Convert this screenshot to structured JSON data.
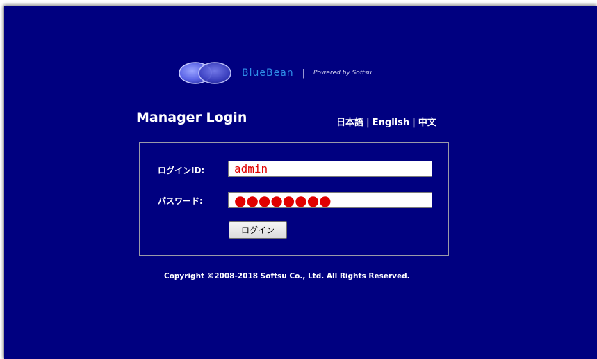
{
  "logo": {
    "icon": "bean-logo-icon",
    "brand": "BlueBean",
    "separator": "|",
    "powered_by": "Powered by Softsu"
  },
  "header": {
    "title": "Manager Login"
  },
  "languages": {
    "japanese": "日本語",
    "english": "English",
    "chinese": "中文",
    "separator": "|"
  },
  "form": {
    "login_id_label": "ログインID:",
    "login_id_value": "admin",
    "password_label": "パスワード:",
    "password_value": "●●●●●●●●",
    "submit_label": "ログイン"
  },
  "footer": {
    "copyright": "Copyright ©2008-2018 Softsu Co., Ltd. All Rights Reserved."
  },
  "colors": {
    "background": "#000080",
    "brand": "#2f8fe8",
    "input_text": "#e00000"
  }
}
